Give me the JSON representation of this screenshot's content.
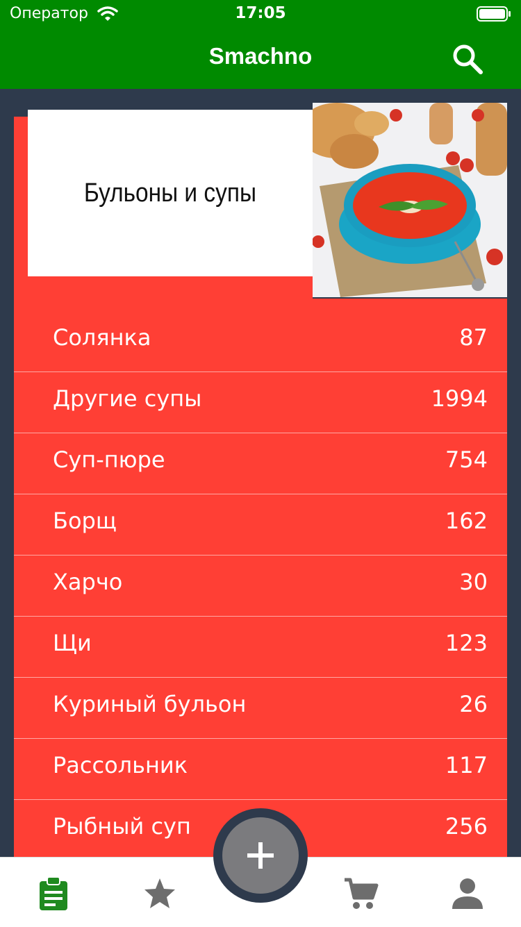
{
  "status_bar": {
    "carrier": "Оператор",
    "time": "17:05"
  },
  "nav_bar": {
    "title": "Smachno"
  },
  "category": {
    "title": "Бульоны и супы",
    "image": "tomato-soup-bowl-photo",
    "items": [
      {
        "name": "Солянка",
        "count": "87"
      },
      {
        "name": "Другие супы",
        "count": "1994"
      },
      {
        "name": "Суп-пюре",
        "count": "754"
      },
      {
        "name": "Борщ",
        "count": "162"
      },
      {
        "name": "Харчо",
        "count": "30"
      },
      {
        "name": "Щи",
        "count": "123"
      },
      {
        "name": "Куриный бульон",
        "count": "26"
      },
      {
        "name": "Рассольник",
        "count": "117"
      },
      {
        "name": "Рыбный суп",
        "count": "256"
      }
    ]
  },
  "tab_bar": {
    "tabs": [
      {
        "icon": "clipboard-icon",
        "active": true
      },
      {
        "icon": "star-icon",
        "active": false
      },
      {
        "icon": "plus-icon",
        "active": false
      },
      {
        "icon": "cart-icon",
        "active": false
      },
      {
        "icon": "person-icon",
        "active": false
      }
    ]
  },
  "colors": {
    "brand_green": "#008a00",
    "list_red": "#ff3f35",
    "background": "#2e3a4c",
    "tab_active": "#1f8a1f",
    "tab_inactive": "#6d6d6d"
  }
}
